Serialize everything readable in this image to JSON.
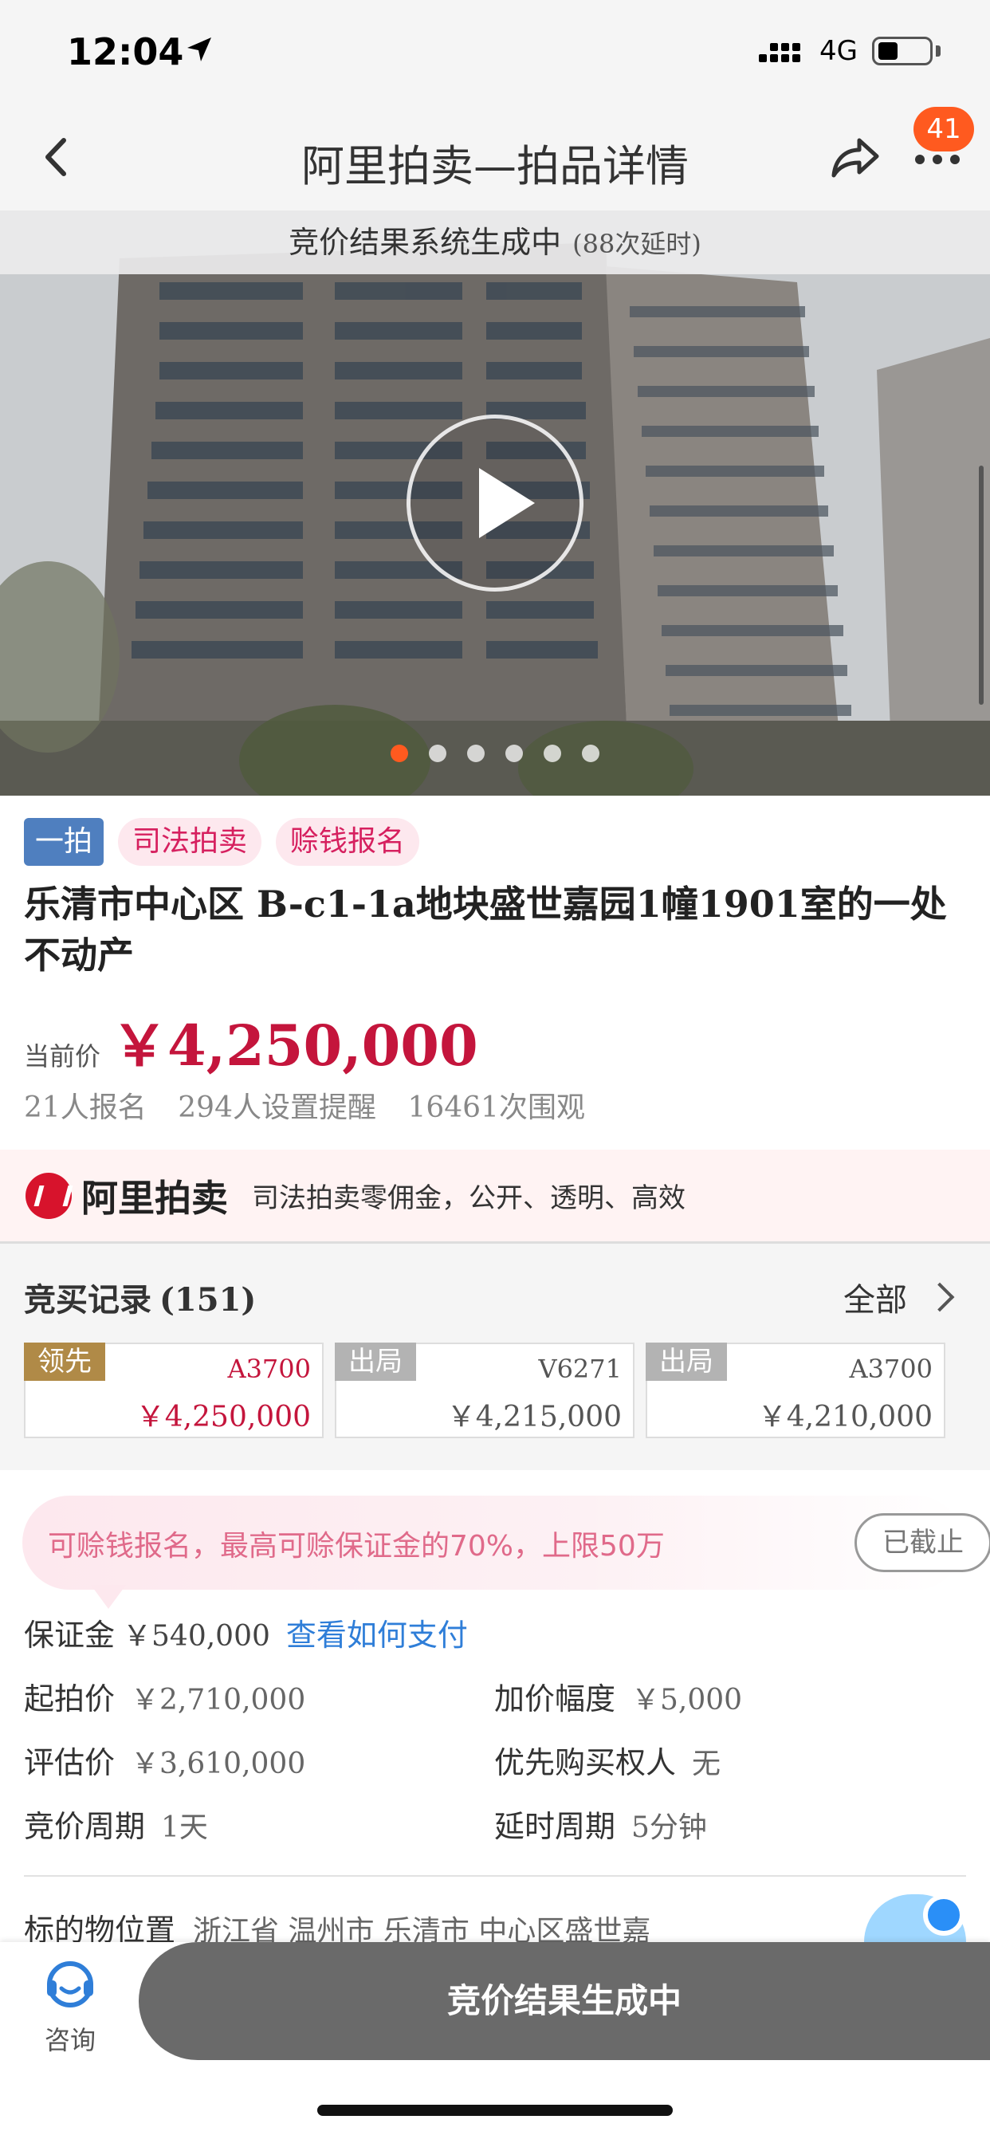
{
  "status_bar": {
    "time": "12:04",
    "network": "4G"
  },
  "nav": {
    "title": "阿里拍卖—拍品详情",
    "badge": "41"
  },
  "hero": {
    "status_text": "竞价结果系统生成中",
    "delay_text": "(88次延时)",
    "slide_count": 6,
    "active_slide": 1
  },
  "tags": [
    "一拍",
    "司法拍卖",
    "赊钱报名"
  ],
  "item": {
    "title": "乐清市中心区 B-c1-1a地块盛世嘉园1幢1901室的一处不动产",
    "price_label": "当前价",
    "price": "￥4,250,000",
    "stats": [
      "21人报名",
      "294人设置提醒",
      "16461次围观"
    ]
  },
  "banner": {
    "brand": "阿里拍卖",
    "slogan": "司法拍卖零佣金，公开、透明、高效"
  },
  "records": {
    "title": "竞买记录",
    "count": "(151)",
    "all_label": "全部",
    "bids": [
      {
        "status": "领先",
        "user": "A3700",
        "price": "￥4,250,000"
      },
      {
        "status": "出局",
        "user": "V6271",
        "price": "￥4,215,000"
      },
      {
        "status": "出局",
        "user": "A3700",
        "price": "￥4,210,000"
      }
    ]
  },
  "notice": {
    "text": "可赊钱报名，最高可赊保证金的70%，上限50万",
    "button": "已截止"
  },
  "deposit": {
    "label": "保证金",
    "value": "￥540,000",
    "link": "查看如何支付"
  },
  "details": {
    "start_price_label": "起拍价",
    "start_price": "￥2,710,000",
    "increment_label": "加价幅度",
    "increment": "￥5,000",
    "appraisal_label": "评估价",
    "appraisal": "￥3,610,000",
    "priority_label": "优先购买权人",
    "priority": "无",
    "period_label": "竞价周期",
    "period": "1天",
    "delay_label": "延时周期",
    "delay": "5分钟"
  },
  "location": {
    "label": "标的物位置",
    "value": "浙江省 温州市 乐清市 中心区盛世嘉"
  },
  "bottom": {
    "consult_label": "咨询",
    "cta_label": "竞价结果生成中"
  },
  "colors": {
    "accent": "#ff5a1f",
    "price_red": "#c4153c",
    "cta_gray": "#6a6a6a",
    "link_blue": "#2f7ed8"
  }
}
